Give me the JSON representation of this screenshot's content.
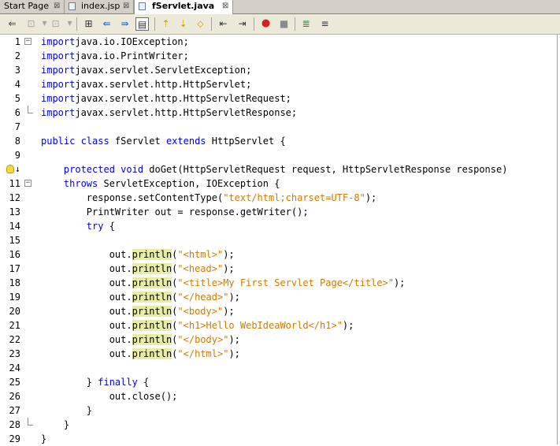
{
  "tabs": [
    {
      "label": "Start Page",
      "active": false
    },
    {
      "label": "index.jsp",
      "active": false
    },
    {
      "label": "fServlet.java",
      "active": true
    }
  ],
  "tab_close_glyph": "⊠",
  "toolbar": {
    "buttons": [
      "back-icon",
      "forward-icon",
      "last-edit-icon",
      "toggle-bookmark-icon",
      "find-prev-icon",
      "find-next-icon",
      "toggle-highlight-icon",
      "prev-bookmark-icon",
      "next-bookmark-icon",
      "shift-left-icon",
      "shift-right-icon",
      "record-macro-icon",
      "stop-macro-icon",
      "comment-icon",
      "uncomment-icon"
    ]
  },
  "editor": {
    "lines": [
      {
        "n": "1",
        "fold": "open",
        "code": [
          [
            "kw",
            "import"
          ],
          [
            "",
            "java.io.IOException;"
          ]
        ]
      },
      {
        "n": "2",
        "code": [
          [
            "kw",
            "import"
          ],
          [
            "",
            "java.io.PrintWriter;"
          ]
        ]
      },
      {
        "n": "3",
        "code": [
          [
            "kw",
            "import"
          ],
          [
            "",
            "javax.servlet.ServletException;"
          ]
        ]
      },
      {
        "n": "4",
        "code": [
          [
            "kw",
            "import"
          ],
          [
            "",
            "javax.servlet.http.HttpServlet;"
          ]
        ]
      },
      {
        "n": "5",
        "code": [
          [
            "kw",
            "import"
          ],
          [
            "",
            "javax.servlet.http.HttpServletRequest;"
          ]
        ]
      },
      {
        "n": "6",
        "fold": "end",
        "code": [
          [
            "kw",
            "import"
          ],
          [
            "",
            "javax.servlet.http.HttpServletResponse;"
          ]
        ]
      },
      {
        "n": "7",
        "code": []
      },
      {
        "n": "8",
        "code": [
          [
            "kw",
            "public class"
          ],
          [
            "",
            " fServlet "
          ],
          [
            "kw",
            "extends"
          ],
          [
            "",
            " HttpServlet {"
          ]
        ]
      },
      {
        "n": "9",
        "code": []
      },
      {
        "n": "",
        "bulb": true,
        "code": [
          [
            "",
            "    "
          ],
          [
            "kw",
            "protected void"
          ],
          [
            "",
            " doGet(HttpServletRequest request, HttpServletResponse response)"
          ]
        ]
      },
      {
        "n": "11",
        "fold": "open",
        "code": [
          [
            "",
            "    "
          ],
          [
            "kw",
            "throws"
          ],
          [
            "",
            " ServletException, IOException {"
          ]
        ]
      },
      {
        "n": "12",
        "code": [
          [
            "",
            "        response.setContentType("
          ],
          [
            "str",
            "\"text/html;charset=UTF-8\""
          ],
          [
            "",
            ");"
          ]
        ]
      },
      {
        "n": "13",
        "code": [
          [
            "",
            "        PrintWriter out = response.getWriter();"
          ]
        ]
      },
      {
        "n": "14",
        "code": [
          [
            "",
            "        "
          ],
          [
            "kw",
            "try"
          ],
          [
            "",
            " {"
          ]
        ]
      },
      {
        "n": "15",
        "code": []
      },
      {
        "n": "16",
        "code": [
          [
            "",
            "            out."
          ],
          [
            "hl",
            "println"
          ],
          [
            "",
            "("
          ],
          [
            "str",
            "\"<html>\""
          ],
          [
            "",
            ");"
          ]
        ]
      },
      {
        "n": "17",
        "code": [
          [
            "",
            "            out."
          ],
          [
            "hl",
            "println"
          ],
          [
            "",
            "("
          ],
          [
            "str",
            "\"<head>\""
          ],
          [
            "",
            ");"
          ]
        ]
      },
      {
        "n": "18",
        "code": [
          [
            "",
            "            out."
          ],
          [
            "hl",
            "println"
          ],
          [
            "",
            "("
          ],
          [
            "str",
            "\"<title>My First Servlet Page</title>\""
          ],
          [
            "",
            ");"
          ]
        ]
      },
      {
        "n": "19",
        "code": [
          [
            "",
            "            out."
          ],
          [
            "hl",
            "println"
          ],
          [
            "",
            "("
          ],
          [
            "str",
            "\"</head>\""
          ],
          [
            "",
            ");"
          ]
        ]
      },
      {
        "n": "20",
        "code": [
          [
            "",
            "            out."
          ],
          [
            "hl",
            "println"
          ],
          [
            "",
            "("
          ],
          [
            "str",
            "\"<body>\""
          ],
          [
            "",
            ");"
          ]
        ]
      },
      {
        "n": "21",
        "code": [
          [
            "",
            "            out."
          ],
          [
            "hl",
            "println"
          ],
          [
            "",
            "("
          ],
          [
            "str",
            "\"<h1>Hello WebIdeaWorld</h1>\""
          ],
          [
            "",
            ");"
          ]
        ]
      },
      {
        "n": "22",
        "code": [
          [
            "",
            "            out."
          ],
          [
            "hl",
            "println"
          ],
          [
            "",
            "("
          ],
          [
            "str",
            "\"</body>\""
          ],
          [
            "",
            ");"
          ]
        ]
      },
      {
        "n": "23",
        "code": [
          [
            "",
            "            out."
          ],
          [
            "hl",
            "println"
          ],
          [
            "",
            "("
          ],
          [
            "str",
            "\"</html>\""
          ],
          [
            "",
            ");"
          ]
        ]
      },
      {
        "n": "24",
        "code": []
      },
      {
        "n": "25",
        "code": [
          [
            "",
            "        } "
          ],
          [
            "kw",
            "finally"
          ],
          [
            "",
            " {"
          ]
        ]
      },
      {
        "n": "26",
        "code": [
          [
            "",
            "            out.close();"
          ]
        ]
      },
      {
        "n": "27",
        "code": [
          [
            "",
            "        }"
          ]
        ]
      },
      {
        "n": "28",
        "fold": "end",
        "code": [
          [
            "",
            "    }"
          ]
        ]
      },
      {
        "n": "29",
        "code": [
          [
            "",
            "}"
          ]
        ]
      }
    ]
  }
}
